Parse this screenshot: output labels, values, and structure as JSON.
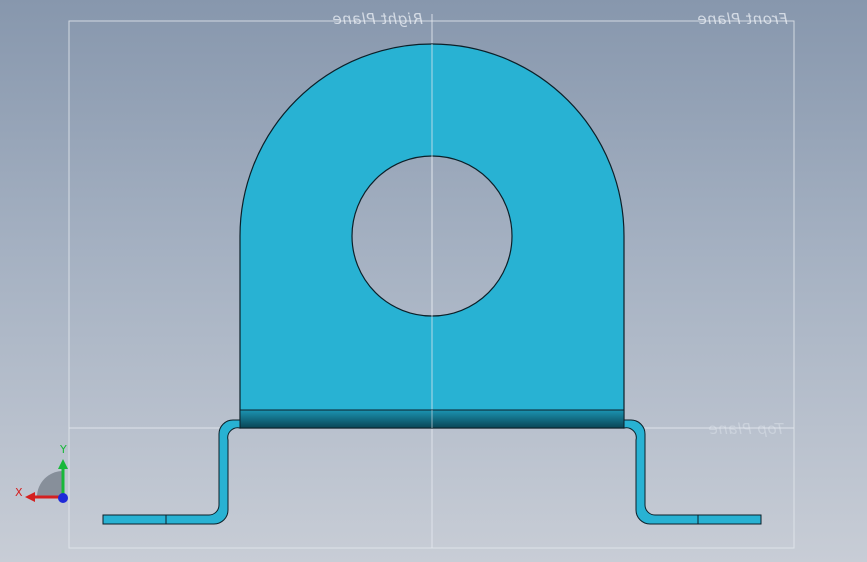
{
  "view": {
    "background_top": "#8797ad",
    "background_bottom": "#c8cdd6"
  },
  "planes": {
    "right_plane_label": "Right Plane",
    "front_plane_label": "Front Plane",
    "top_plane_label": "Top Plane"
  },
  "part": {
    "face_color": "#28b2d3",
    "edge_color": "#0b1f28",
    "bend_shadow_color": "#0d5f74"
  },
  "triad": {
    "x_label": "X",
    "y_label": "Y",
    "x_color": "#d42020",
    "y_color": "#18b83a",
    "z_color": "#1f2ad8"
  }
}
